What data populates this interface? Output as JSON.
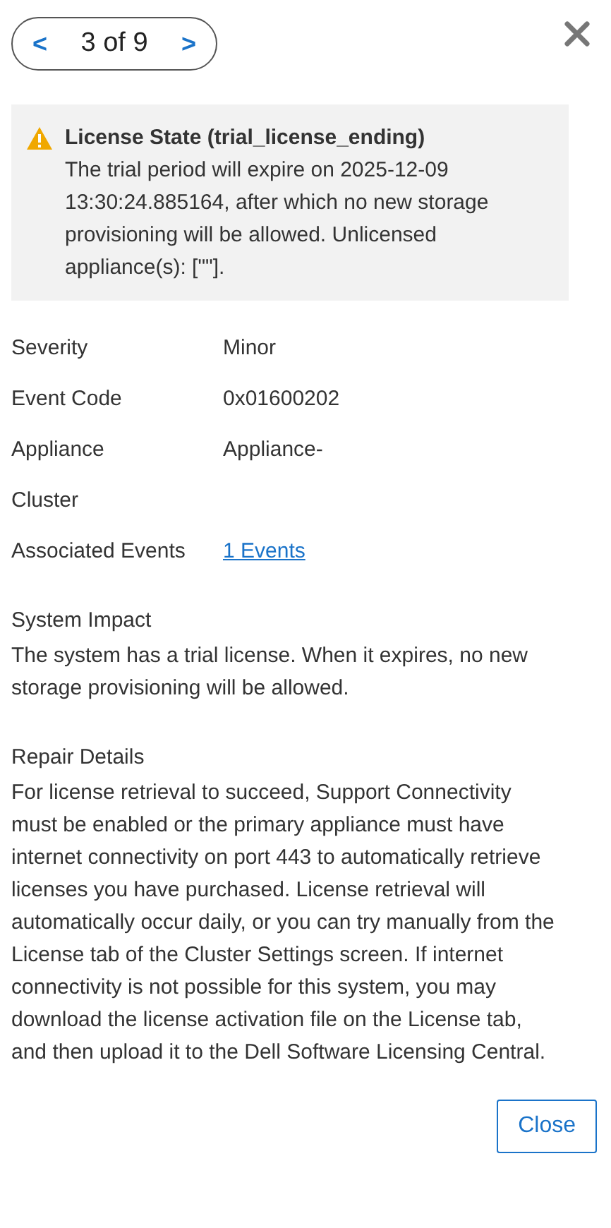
{
  "pager": {
    "prev": "<",
    "label": "3 of 9",
    "next": ">"
  },
  "alert": {
    "title": "License State (trial_license_ending)",
    "message": "The trial period will expire on 2025-12-09 13:30:24.885164, after which no new storage provisioning will be allowed. Unlicensed appliance(s): [\"\"]."
  },
  "details": [
    {
      "label": "Severity",
      "value": "Minor",
      "kind": "text"
    },
    {
      "label": "Event Code",
      "value": "0x01600202",
      "kind": "text"
    },
    {
      "label": "Appliance",
      "value": "Appliance-",
      "kind": "text"
    },
    {
      "label": "Cluster",
      "kind": "text"
    },
    {
      "label": "Associated Events",
      "value": "1 Events",
      "kind": "link"
    }
  ],
  "sections": [
    {
      "title": "System Impact",
      "body": "The system has a trial license. When it expires, no new storage provisioning will be allowed."
    },
    {
      "title": "Repair Details",
      "body": "For license retrieval to succeed, Support Connectivity must be enabled or the primary appliance must have internet connectivity on port 443 to automatically retrieve licenses you have purchased. License retrieval will automatically occur daily, or you can try manually from the License tab of the Cluster Settings screen. If internet connectivity is not possible for this system, you may download the license activation file on the License tab, and then upload it to the Dell Software Licensing Central."
    }
  ],
  "footer": {
    "button": "Close"
  }
}
